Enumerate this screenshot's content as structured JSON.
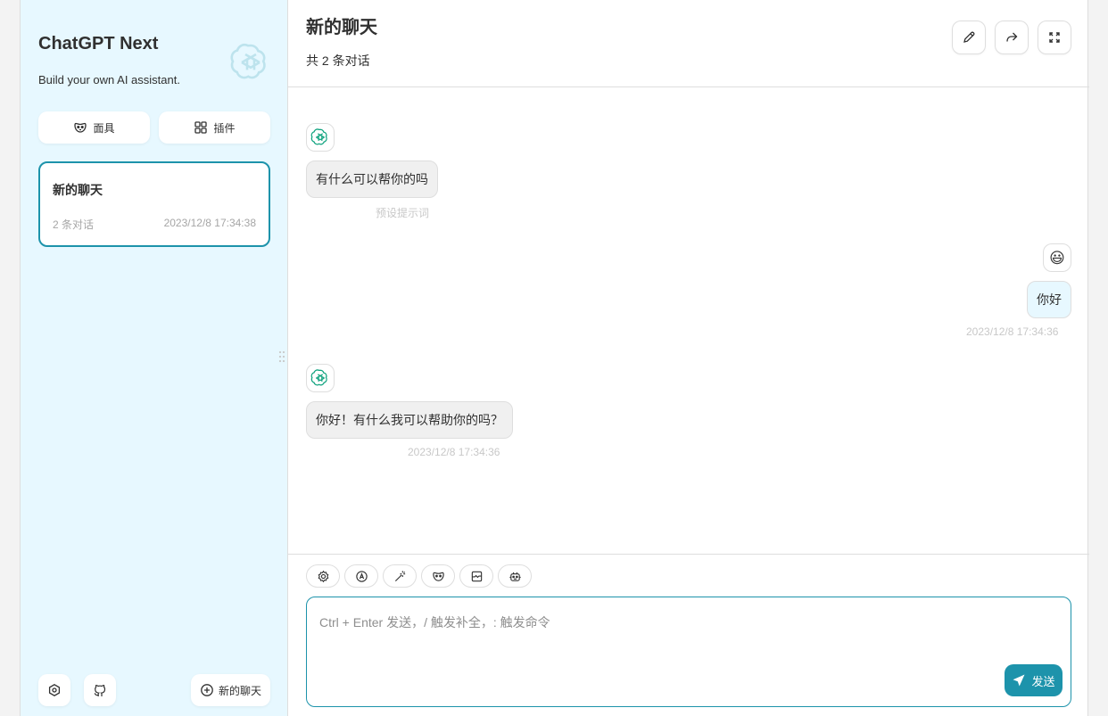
{
  "sidebar": {
    "title": "ChatGPT Next",
    "subtitle": "Build your own AI assistant.",
    "mask_label": "面具",
    "plugin_label": "插件",
    "chats": [
      {
        "title": "新的聊天",
        "count": "2 条对话",
        "time": "2023/12/8 17:34:38"
      }
    ],
    "new_chat_label": "新的聊天"
  },
  "header": {
    "title": "新的聊天",
    "subtitle": "共 2 条对话"
  },
  "messages": [
    {
      "role": "bot",
      "text": "有什么可以帮你的吗",
      "meta": "预设提示词"
    },
    {
      "role": "user",
      "text": "你好",
      "meta": "2023/12/8 17:34:36",
      "avatar": "😃"
    },
    {
      "role": "bot",
      "text": "你好！有什么我可以帮助你的吗？",
      "meta": "2023/12/8 17:34:36"
    }
  ],
  "input": {
    "placeholder": "Ctrl + Enter 发送，/ 触发补全，: 触发命令",
    "send_label": "发送"
  },
  "colors": {
    "accent": "#1d93ab",
    "sidebar_bg": "#e7f8ff",
    "bot_bubble": "#f0f0f0",
    "user_bubble": "#e7f8ff"
  }
}
